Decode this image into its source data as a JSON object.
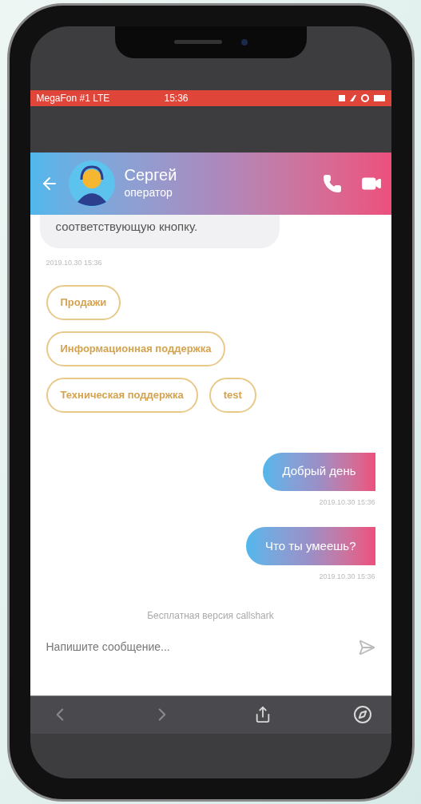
{
  "status_bar": {
    "carrier": "MegaFon #1 LTE",
    "time": "15:36"
  },
  "header": {
    "name": "Сергей",
    "role": "оператор"
  },
  "incoming": {
    "text": "соответствующую кнопку.",
    "time": "2019.10.30 15:36"
  },
  "quick_replies": [
    [
      "Продажи"
    ],
    [
      "Информационная поддержка"
    ],
    [
      "Техническая поддержка",
      "test"
    ]
  ],
  "outgoing": [
    {
      "text": "Добрый день",
      "time": "2019.10.30 15:36"
    },
    {
      "text": "Что ты умеешь?",
      "time": "2019.10.30 15:36"
    }
  ],
  "notice": "Бесплатная версия callshark",
  "composer": {
    "placeholder": "Напишите сообщение..."
  }
}
